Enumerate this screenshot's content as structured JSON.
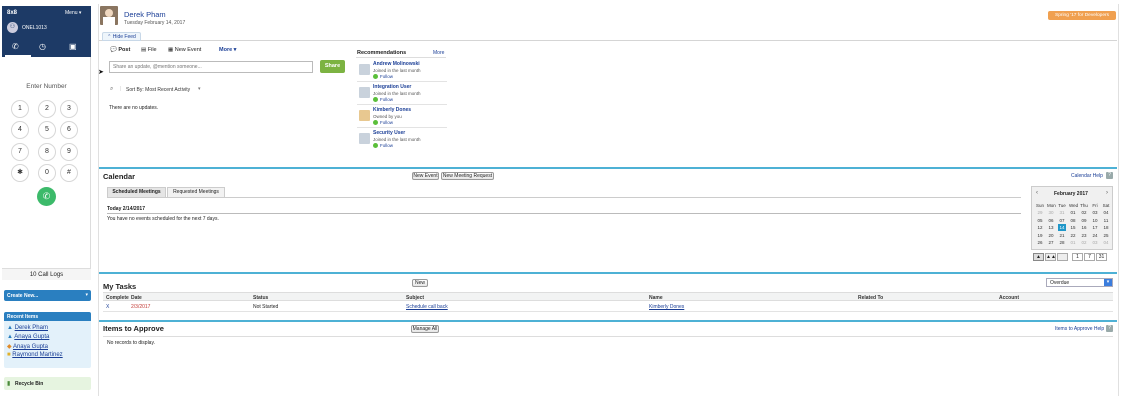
{
  "dialer": {
    "brand": "8x8",
    "menu_label": "Menu ▾",
    "user": "ONEL1013",
    "enter_number": "Enter Number",
    "keys": [
      "1",
      "2",
      "3",
      "4",
      "5",
      "6",
      "7",
      "8",
      "9",
      "✱",
      "0",
      "#"
    ],
    "call_logs": "10 Call Logs"
  },
  "sidebar": {
    "create_new": "Create New...",
    "recent_items_title": "Recent Items",
    "recent_items": [
      "Derek Pham",
      "Anaya Gupta",
      "Anaya Gupta",
      "Raymond Martinez"
    ],
    "recycle_bin": "Recycle Bin"
  },
  "header": {
    "name": "Derek Pham",
    "date": "Tuesday February 14, 2017",
    "hide_feed": "Hide Feed",
    "promo": "Spring '17 for Developers"
  },
  "feed": {
    "tabs": [
      "Post",
      "File",
      "New Event",
      "More ▾"
    ],
    "placeholder": "Share an update, @mention someone...",
    "share": "Share",
    "sort": "Sort By: Most Recent Activity",
    "empty": "There are no updates."
  },
  "recommendations": {
    "title": "Recommendations",
    "more": "More",
    "items": [
      {
        "name": "Andrew Molinowski",
        "desc": "Joined in the last month",
        "action": "Follow"
      },
      {
        "name": "Integration User",
        "desc": "Joined in the last month",
        "action": "Follow"
      },
      {
        "name": "Kimberly Dones",
        "desc": "Owned by you",
        "action": "Follow"
      },
      {
        "name": "Security User",
        "desc": "Joined in the last month",
        "action": "Follow"
      }
    ]
  },
  "calendar": {
    "title": "Calendar",
    "new_event": "New Event",
    "new_meeting": "New Meeting Request",
    "help": "Calendar Help",
    "tabs": [
      "Scheduled Meetings",
      "Requested Meetings"
    ],
    "today_label": "Today 2/14/2017",
    "no_events": "You have no events scheduled for the next 7 days.",
    "month": "February 2017",
    "weekdays": [
      "Sun",
      "Mon",
      "Tue",
      "Wed",
      "Thu",
      "Fri",
      "Sat"
    ],
    "weeks": [
      [
        "29",
        "30",
        "31",
        "01",
        "02",
        "03",
        "04"
      ],
      [
        "05",
        "06",
        "07",
        "08",
        "09",
        "10",
        "11"
      ],
      [
        "12",
        "13",
        "14",
        "15",
        "16",
        "17",
        "18"
      ],
      [
        "19",
        "20",
        "21",
        "22",
        "23",
        "24",
        "25"
      ],
      [
        "26",
        "27",
        "28",
        "01",
        "02",
        "03",
        "04"
      ]
    ],
    "view_buttons": [
      "1",
      "7",
      "31"
    ]
  },
  "tasks": {
    "title": "My Tasks",
    "new": "New",
    "filter": "Overdue",
    "columns": [
      "Complete",
      "Date",
      "Status",
      "Subject",
      "Name",
      "Related To",
      "Account"
    ],
    "rows": [
      {
        "complete": "X",
        "date": "2/3/2017",
        "status": "Not Started",
        "subject": "Schedule call back",
        "name": "Kimberly Dones",
        "related": "",
        "account": ""
      }
    ]
  },
  "approve": {
    "title": "Items to Approve",
    "manage": "Manage All",
    "help": "Items to Approve Help",
    "empty": "No records to display."
  },
  "colors": {
    "navy": "#1d3a66",
    "accent_blue": "#4eb1d5",
    "call_green": "#3cba6a",
    "promo_orange": "#f0a050",
    "share_green": "#7cb342"
  }
}
